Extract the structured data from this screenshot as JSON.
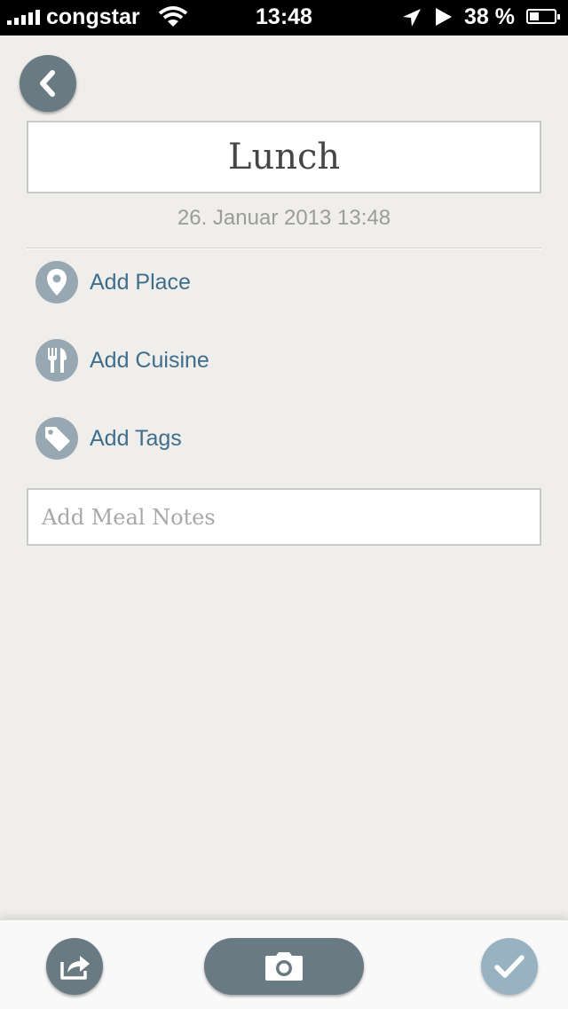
{
  "status_bar": {
    "carrier": "congstar",
    "time": "13:48",
    "battery": "38 %"
  },
  "meal": {
    "title": "Lunch",
    "date": "26. Januar 2013 13:48"
  },
  "actions": {
    "add_place": "Add Place",
    "add_cuisine": "Add Cuisine",
    "add_tags": "Add Tags"
  },
  "notes": {
    "placeholder": "Add Meal Notes",
    "value": ""
  },
  "icons": {
    "back": "chevron-left-icon",
    "place": "map-pin-icon",
    "cuisine": "fork-knife-icon",
    "tags": "tag-icon",
    "share": "share-icon",
    "camera": "camera-icon",
    "done": "checkmark-icon"
  },
  "colors": {
    "background": "#f0eeea",
    "button_dark": "#6a7a82",
    "icon_circle": "#98a8b2",
    "link_text": "#3f6e8d",
    "done_button": "#98b2c2"
  }
}
